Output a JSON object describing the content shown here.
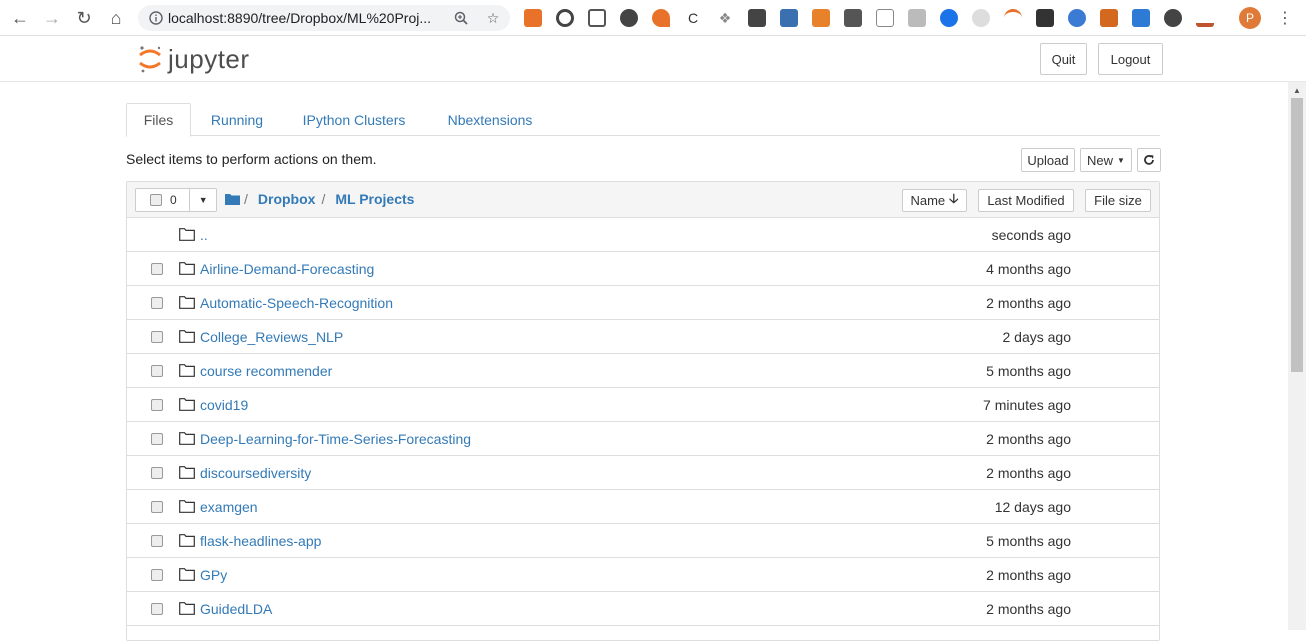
{
  "browser": {
    "url": "localhost:8890/tree/Dropbox/ML%20Proj...",
    "profile_initial": "P"
  },
  "header": {
    "logo_text": "jupyter",
    "quit_label": "Quit",
    "logout_label": "Logout"
  },
  "tabs": [
    {
      "label": "Files"
    },
    {
      "label": "Running"
    },
    {
      "label": "IPython Clusters"
    },
    {
      "label": "Nbextensions"
    }
  ],
  "toolbar": {
    "hint": "Select items to perform actions on them.",
    "upload_label": "Upload",
    "new_label": "New"
  },
  "list": {
    "selected_count": "0",
    "breadcrumbs": [
      "Dropbox",
      "ML Projects"
    ],
    "sort_name_label": "Name",
    "sort_modified_label": "Last Modified",
    "sort_size_label": "File size",
    "rows": [
      {
        "name": "..",
        "modified": "seconds ago"
      },
      {
        "name": "Airline-Demand-Forecasting",
        "modified": "4 months ago"
      },
      {
        "name": "Automatic-Speech-Recognition",
        "modified": "2 months ago"
      },
      {
        "name": "College_Reviews_NLP",
        "modified": "2 days ago"
      },
      {
        "name": "course recommender",
        "modified": "5 months ago"
      },
      {
        "name": "covid19",
        "modified": "7 minutes ago"
      },
      {
        "name": "Deep-Learning-for-Time-Series-Forecasting",
        "modified": "2 months ago"
      },
      {
        "name": "discoursediversity",
        "modified": "2 months ago"
      },
      {
        "name": "examgen",
        "modified": "12 days ago"
      },
      {
        "name": "flask-headlines-app",
        "modified": "5 months ago"
      },
      {
        "name": "GPy",
        "modified": "2 months ago"
      },
      {
        "name": "GuidedLDA",
        "modified": "2 months ago"
      }
    ]
  },
  "colors": {
    "link": "#337ab7",
    "jupyter_orange": "#f37726"
  }
}
